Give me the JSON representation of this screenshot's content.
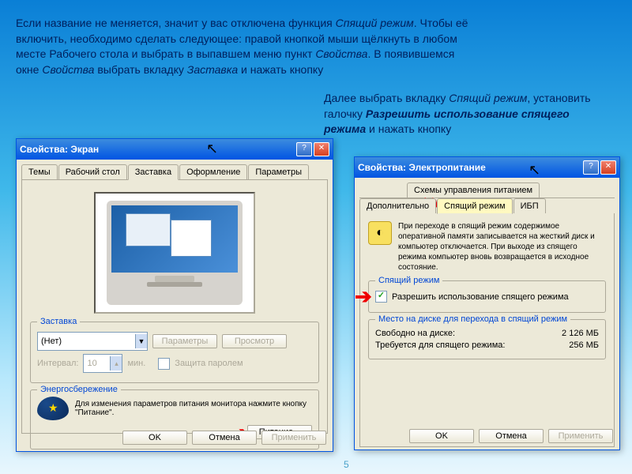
{
  "instruction1": {
    "t1": "Если название не меняется, значит у вас отключена функция ",
    "i1": "Спящий режим",
    "t2": ". Чтобы её включить, необходимо сделать следующее: правой кнопкой мыши щёлкнуть в любом месте Рабочего стола и выбрать в выпавшем меню пункт ",
    "i2": "Свойства",
    "t3": ". В появившемся окне ",
    "i3": "Свойства",
    "t4": " выбрать вкладку ",
    "i4": "Заставка",
    "t5": " и нажать кнопку"
  },
  "instruction2": {
    "t1": "Далее выбрать вкладку ",
    "i1": "Спящий режим",
    "t2": ", установить галочку ",
    "i2": "Разрешить использование спящего режима",
    "t3": " и нажать кнопку"
  },
  "dialog1": {
    "title": "Свойства: Экран",
    "tabs": [
      "Темы",
      "Рабочий стол",
      "Заставка",
      "Оформление",
      "Параметры"
    ],
    "screensaver_group": "Заставка",
    "screensaver_value": "(Нет)",
    "btn_params": "Параметры",
    "btn_preview": "Просмотр",
    "interval_label": "Интервал:",
    "interval_value": "10",
    "interval_unit": "мин.",
    "password_protect": "Защита паролем",
    "energy_group": "Энергосбережение",
    "energy_text": "Для изменения параметров питания монитора нажмите кнопку \"Питание\".",
    "btn_power": "Питание...",
    "btn_ok": "OK",
    "btn_cancel": "Отмена",
    "btn_apply": "Применить"
  },
  "dialog2": {
    "title": "Свойства: Электропитание",
    "tabs_row1": [
      "Схемы управления питанием"
    ],
    "tabs_row2": [
      "Дополнительно",
      "Спящий режим",
      "ИБП"
    ],
    "info": "При переходе в спящий режим содержимое оперативной памяти записывается на жесткий диск и компьютер отключается. При выходе из спящего режима компьютер вновь возвращается в исходное состояние.",
    "sleep_group": "Спящий режим",
    "allow_sleep": "Разрешить использование спящего режима",
    "disk_group": "Место на диске для перехода в спящий режим",
    "free_label": "Свободно на диске:",
    "free_value": "2 126 МБ",
    "need_label": "Требуется для спящего режима:",
    "need_value": "256 МБ",
    "btn_ok": "OK",
    "btn_cancel": "Отмена",
    "btn_apply": "Применить"
  },
  "page_number": "5"
}
